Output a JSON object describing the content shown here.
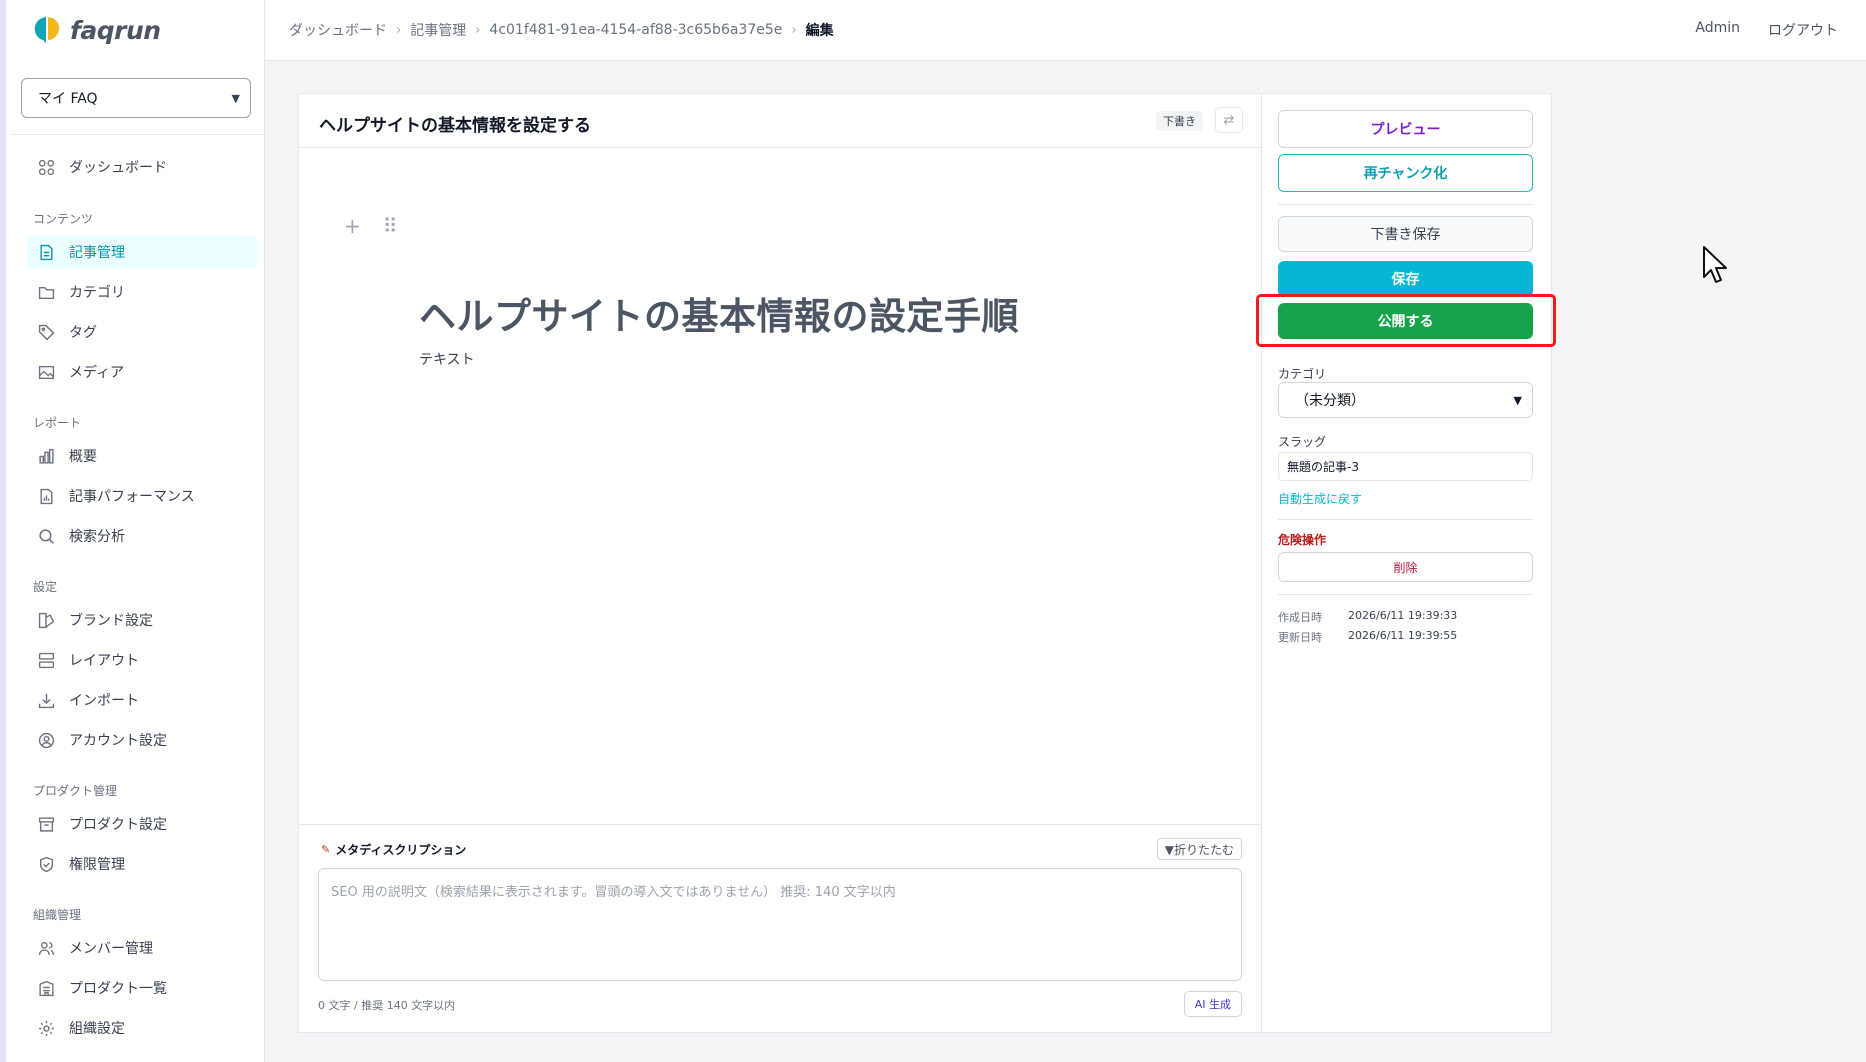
{
  "brand": {
    "name": "faqrun"
  },
  "faq_selector": {
    "value": "マイ FAQ"
  },
  "sidebar": {
    "dashboard": "ダッシュボード",
    "sections": {
      "content": "コンテンツ",
      "report": "レポート",
      "settings": "設定",
      "product_mgmt": "プロダクト管理",
      "org_mgmt": "組織管理"
    },
    "items": {
      "articles": "記事管理",
      "categories": "カテゴリ",
      "tags": "タグ",
      "media": "メディア",
      "overview": "概要",
      "article_perf": "記事パフォーマンス",
      "search_analysis": "検索分析",
      "brand": "ブランド設定",
      "layout": "レイアウト",
      "import": "インポート",
      "account": "アカウント設定",
      "product_settings": "プロダクト設定",
      "permissions": "権限管理",
      "members": "メンバー管理",
      "product_list": "プロダクト一覧",
      "org_settings": "組織設定"
    }
  },
  "breadcrumb": {
    "dashboard": "ダッシュボード",
    "articles": "記事管理",
    "id": "4c01f481-91ea-4154-af88-3c65b6a37e5e",
    "current": "編集"
  },
  "header": {
    "user": "Admin",
    "logout": "ログアウト"
  },
  "editor": {
    "title": "ヘルプサイトの基本情報を設定する",
    "status_badge": "下書き",
    "heading": "ヘルプサイトの基本情報の設定手順",
    "paragraph": "テキスト"
  },
  "meta": {
    "label": "メタディスクリプション",
    "collapse": "▼折りたたむ",
    "placeholder": "SEO 用の説明文（検索結果に表示されます。冒頭の導入文ではありません） 推奨: 140 文字以内",
    "count": "0 文字 / 推奨 140 文字以内",
    "ai_button": "AI 生成"
  },
  "side_panel": {
    "preview": "プレビュー",
    "rechunk": "再チャンク化",
    "save_draft": "下書き保存",
    "save": "保存",
    "publish": "公開する",
    "category_label": "カテゴリ",
    "category_value": "（未分類）",
    "slug_label": "スラッグ",
    "slug_value": "無題の記事-3",
    "regen_slug": "自動生成に戻す",
    "danger_label": "危険操作",
    "delete": "削除",
    "created_label": "作成日時",
    "created_value": "2026/6/11 19:39:33",
    "updated_label": "更新日時",
    "updated_value": "2026/6/11 19:39:55"
  },
  "colors": {
    "accent": "#06b6d4",
    "publish": "#16a34a",
    "highlight": "#ef1c1c",
    "preview": "#7e22ce"
  }
}
